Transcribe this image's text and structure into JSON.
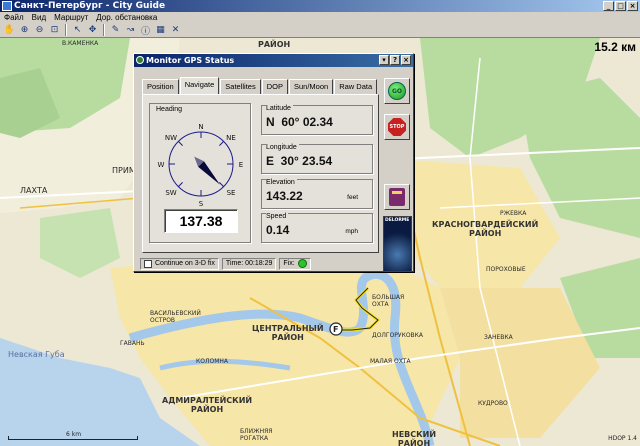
{
  "window": {
    "title": "Санкт-Петербург - City Guide",
    "buttons": [
      "_",
      "□",
      "×"
    ]
  },
  "menu": [
    "Файл",
    "Вид",
    "Маршрут",
    "Дор. обстановка"
  ],
  "toolbar_icons": [
    "hand-icon",
    "zoom-in-icon",
    "zoom-out-icon",
    "zoom-window-icon",
    "select-arrow-icon",
    "gps-icon",
    "edit-icon",
    "route-icon",
    "info-icon",
    "grid-icon",
    "close-layer-icon"
  ],
  "map": {
    "scale_km": "15.2 км",
    "scale_bar_label": "6 km",
    "hdop": "HDOP 1.4",
    "labels": [
      {
        "text": "РАЙОН"
      },
      {
        "text": "ЛАХТА"
      },
      {
        "text": "ПРИМ"
      },
      {
        "text": "Невская Губа"
      },
      {
        "text": "ЦЕНТРАЛЬНЫЙ\nРАЙОН"
      },
      {
        "text": "АДМИРАЛТЕЙСКИЙ\nРАЙОН"
      },
      {
        "text": "НЕВСКИЙ\nРАЙОН"
      },
      {
        "text": "КРАСНОГВАРДЕЙСКИЙ\nРАЙОН"
      },
      {
        "text": "В.КАМЕНКА"
      },
      {
        "text": "БОЛЬШАЯ\nОХТА"
      },
      {
        "text": "ВАСИЛЬЕВСКИЙ\nОСТРОВ"
      },
      {
        "text": "ГАВАНЬ"
      },
      {
        "text": "КОЛОМНА"
      },
      {
        "text": "ДОЛГОРУКОВКА"
      },
      {
        "text": "МАЛАЯ ОХТА"
      },
      {
        "text": "ЗАНЕВКА"
      },
      {
        "text": "РЖЕВКА"
      },
      {
        "text": "ПОРОХОВЫЕ"
      },
      {
        "text": "КУДРОВО"
      },
      {
        "text": "БЛИЖНЯЯ\nРОГАТКА"
      }
    ]
  },
  "dialog": {
    "title": "Monitor GPS Status",
    "title_buttons": [
      "▾",
      "?",
      "×"
    ],
    "tabs": [
      "Position",
      "Navigate",
      "Satellites",
      "DOP",
      "Sun/Moon",
      "Raw Data"
    ],
    "active_tab": "Navigate",
    "heading": {
      "label": "Heading",
      "value": "137.38",
      "heading_deg": 137.38,
      "compass_points": [
        "N",
        "NE",
        "E",
        "SE",
        "S",
        "SW",
        "W",
        "NW"
      ]
    },
    "latitude": {
      "label": "Latitude",
      "value": "N  60° 02.34"
    },
    "longitude": {
      "label": "Longitude",
      "value": "E  30° 23.54"
    },
    "elevation": {
      "label": "Elevation",
      "value": "143.22",
      "unit": "feet"
    },
    "speed": {
      "label": "Speed",
      "value": "0.14",
      "unit": "mph"
    },
    "status": {
      "continue_3d": "Continue on 3-D fix",
      "time_label": "Time:",
      "time_value": "00:18:29",
      "fix_label": "Fix:"
    },
    "side_buttons": {
      "go": "GO",
      "stop": "STOP",
      "globe_brand": "DELORME"
    }
  }
}
